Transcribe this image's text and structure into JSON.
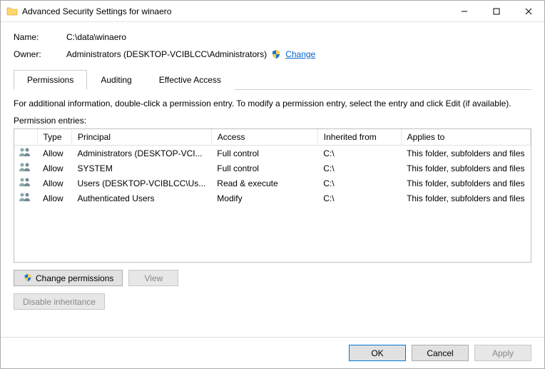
{
  "titlebar": {
    "title": "Advanced Security Settings for winaero"
  },
  "name": {
    "label": "Name:",
    "value": "C:\\data\\winaero"
  },
  "owner": {
    "label": "Owner:",
    "value": "Administrators (DESKTOP-VCIBLCC\\Administrators)",
    "change": "Change"
  },
  "tabs": {
    "permissions": "Permissions",
    "auditing": "Auditing",
    "effective": "Effective Access"
  },
  "info": "For additional information, double-click a permission entry. To modify a permission entry, select the entry and click Edit (if available).",
  "subhead": "Permission entries:",
  "columns": {
    "type": "Type",
    "principal": "Principal",
    "access": "Access",
    "inherited": "Inherited from",
    "applies": "Applies to"
  },
  "rows": [
    {
      "type": "Allow",
      "principal": "Administrators (DESKTOP-VCI...",
      "access": "Full control",
      "inherited": "C:\\",
      "applies": "This folder, subfolders and files"
    },
    {
      "type": "Allow",
      "principal": "SYSTEM",
      "access": "Full control",
      "inherited": "C:\\",
      "applies": "This folder, subfolders and files"
    },
    {
      "type": "Allow",
      "principal": "Users (DESKTOP-VCIBLCC\\Us...",
      "access": "Read & execute",
      "inherited": "C:\\",
      "applies": "This folder, subfolders and files"
    },
    {
      "type": "Allow",
      "principal": "Authenticated Users",
      "access": "Modify",
      "inherited": "C:\\",
      "applies": "This folder, subfolders and files"
    }
  ],
  "buttons": {
    "change_permissions": "Change permissions",
    "view": "View",
    "disable_inheritance": "Disable inheritance",
    "ok": "OK",
    "cancel": "Cancel",
    "apply": "Apply"
  }
}
